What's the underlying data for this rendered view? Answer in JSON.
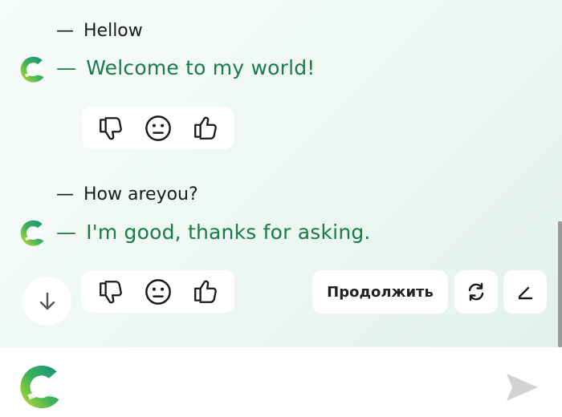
{
  "messages": [
    {
      "user_dash": "—",
      "user_text": "Hellow",
      "bot_dash": "—",
      "bot_text": "Welcome to my world!"
    },
    {
      "user_dash": "—",
      "user_text": "How areyou?",
      "bot_dash": "—",
      "bot_text": "I'm good, thanks for asking."
    }
  ],
  "feedback_icons": [
    "thumbs-down-icon",
    "neutral-face-icon",
    "thumbs-up-icon"
  ],
  "actions": {
    "continue_label": "Продолжить",
    "regenerate_icon": "refresh-icon",
    "edit_icon": "pen-icon"
  },
  "scroll_down_icon": "arrow-down-icon",
  "input": {
    "logo_icon": "app-logo-icon",
    "send_icon": "send-icon"
  },
  "colors": {
    "bot_text": "#1a7a4a",
    "user_text": "#1a1a1a",
    "logo_green": "#2fae5a",
    "logo_lime": "#b8d626",
    "logo_teal": "#1a9a8a",
    "send_icon": "#d0d0d0"
  }
}
